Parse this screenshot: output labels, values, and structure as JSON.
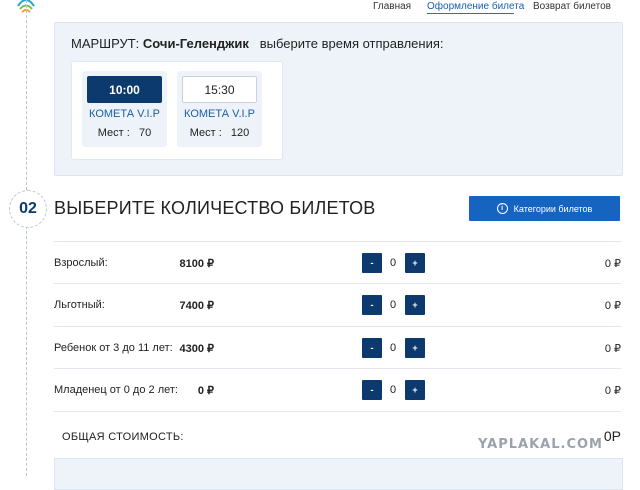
{
  "nav": {
    "links": [
      "Главная",
      "Оформление билета",
      "Возврат билетов"
    ]
  },
  "route": {
    "prefix": "МАРШРУТ:",
    "name": "Сочи-Геленджик",
    "instruction": "выберите время отправления:",
    "options": [
      {
        "time": "10:00",
        "ship": "КОМЕТА V.I.P",
        "seats": "Мест :   70",
        "selected": true
      },
      {
        "time": "15:30",
        "ship": "КОМЕТА V.I.P",
        "seats": "Мест :   120",
        "selected": false
      }
    ]
  },
  "step": {
    "number": "02",
    "title": "ВЫБЕРИТЕ КОЛИЧЕСТВО БИЛЕТОВ",
    "categories_button": "Категории билетов"
  },
  "tickets": [
    {
      "label": "Взрослый:",
      "price": "8100 ₽",
      "qty": "0",
      "total": "0 ₽"
    },
    {
      "label": "Льготный:",
      "price": "7400 ₽",
      "qty": "0",
      "total": "0 ₽"
    },
    {
      "label": "Ребенок от 3 до 11 лет:",
      "price": "4300 ₽",
      "qty": "0",
      "total": "0 ₽"
    },
    {
      "label": "Младенец от 0 до 2 лет:",
      "price": "0 ₽",
      "qty": "0",
      "total": "0 ₽"
    }
  ],
  "controls": {
    "minus": "-",
    "plus": "+"
  },
  "total": {
    "label": "ОБЩАЯ СТОИМОСТЬ:",
    "value": "0Р"
  },
  "watermark": "YAPLAKAL.COM",
  "colors": {
    "accent": "#0c3a6e",
    "button": "#1565c0",
    "panel": "#eef3f9"
  }
}
